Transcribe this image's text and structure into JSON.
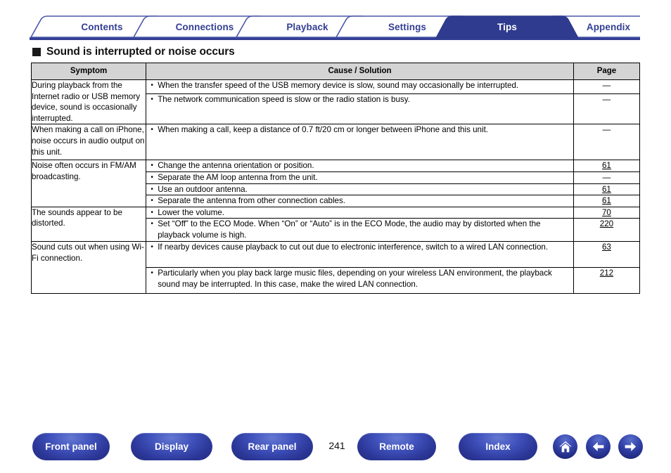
{
  "tabs": [
    {
      "label": "Contents",
      "active": false
    },
    {
      "label": "Connections",
      "active": false
    },
    {
      "label": "Playback",
      "active": false
    },
    {
      "label": "Settings",
      "active": false
    },
    {
      "label": "Tips",
      "active": true
    },
    {
      "label": "Appendix",
      "active": false
    }
  ],
  "heading": {
    "text": "Sound is interrupted or noise occurs",
    "bullet": "filled-square"
  },
  "table": {
    "headers": {
      "symptom": "Symptom",
      "cause": "Cause / Solution",
      "page": "Page"
    },
    "rows": [
      {
        "symptom": "During playback from the Internet radio or USB memory device, sound is occasionally interrupted.",
        "items": [
          {
            "cause": "When the transfer speed of the USB memory device is slow, sound may occasionally be interrupted.",
            "page": "—",
            "link": false
          },
          {
            "cause": "The network communication speed is slow or the radio station is busy.",
            "page": "—",
            "link": false
          }
        ]
      },
      {
        "symptom": "When making a call on iPhone, noise occurs in audio output on this unit.",
        "items": [
          {
            "cause": "When making a call, keep a distance of 0.7 ft/20 cm or longer between iPhone and this unit.",
            "page": "—",
            "link": false
          }
        ]
      },
      {
        "symptom": "Noise often occurs in FM/AM broadcasting.",
        "items": [
          {
            "cause": "Change the antenna orientation or position.",
            "page": "61",
            "link": true
          },
          {
            "cause": "Separate the AM loop antenna from the unit.",
            "page": "—",
            "link": false
          },
          {
            "cause": "Use an outdoor antenna.",
            "page": "61",
            "link": true
          },
          {
            "cause": "Separate the antenna from other connection cables.",
            "page": "61",
            "link": true
          }
        ]
      },
      {
        "symptom": "The sounds appear to be distorted.",
        "items": [
          {
            "cause": "Lower the volume.",
            "page": "70",
            "link": true
          },
          {
            "cause": "Set “Off” to the ECO Mode. When “On” or “Auto” is in the ECO Mode, the audio may by distorted when the playback volume is high.",
            "page": "220",
            "link": true
          }
        ]
      },
      {
        "symptom": "Sound cuts out when using Wi-Fi connection.",
        "items": [
          {
            "cause": "If nearby devices cause playback to cut out due to electronic interference, switch to a wired LAN connection.",
            "page": "63",
            "link": true
          },
          {
            "cause": "Particularly when you play back large music files, depending on your wireless LAN environment, the playback sound may be interrupted. In this case, make the wired LAN connection.",
            "page": "212",
            "link": true
          }
        ]
      }
    ]
  },
  "footer": {
    "buttons": [
      {
        "label": "Front panel",
        "name": "front-panel-button"
      },
      {
        "label": "Display",
        "name": "display-button"
      },
      {
        "label": "Rear panel",
        "name": "rear-panel-button"
      },
      {
        "label": "Remote",
        "name": "remote-button"
      },
      {
        "label": "Index",
        "name": "index-button"
      }
    ],
    "page_number": "241",
    "icons": [
      {
        "name": "home-icon"
      },
      {
        "name": "arrow-left-icon"
      },
      {
        "name": "arrow-right-icon"
      }
    ]
  },
  "colors": {
    "brand_blue": "#333f93",
    "tab_active_bg": "#2f3b8e",
    "header_gray": "#d4d4d4",
    "button_blue": "#2b3696"
  }
}
